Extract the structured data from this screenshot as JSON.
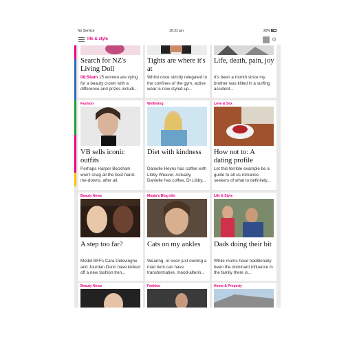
{
  "status_bar": {
    "carrier": "No Service",
    "time": "10:31 am",
    "battery": "20%"
  },
  "header": {
    "section_title": "life & style"
  },
  "cards": [
    {
      "title": "Search for NZ's Living Doll",
      "time": "08:54am",
      "desc": "15 women are vying for a beauty crown with a difference and prizes includi..."
    },
    {
      "title": "Tights are where it's at",
      "desc": "Whilst once strictly relegated to the confines of the gym, active wear is now styled-up..."
    },
    {
      "title": "Life, death, pain, joy",
      "desc": "It's been a month since my brother was killed in a surfing accident..."
    },
    {
      "category": "Fashion",
      "title": "VB sells iconic outfits",
      "desc": "Perhaps Harper Beckham won't snag all the best hand-me-downs, after all."
    },
    {
      "category": "Wellbeing",
      "title": "Diet with kindness",
      "desc": "Danielle Heyns has coffee with Libby Weaver. Actually, Danielle has coffee, Dr Libby..."
    },
    {
      "category": "Love & Sex",
      "title": "How not to: A dating profile",
      "desc": "Let this terrible example be a guide to all us romance seekers of what to definitely..."
    },
    {
      "category": "Beauty News",
      "title": "A step too far?",
      "desc": "Model BFFs Cara Delevingne and Jourdan Dunn have kicked off a new fashion tren..."
    },
    {
      "category": "Moata's Blog Idle",
      "title": "Cats on my ankles",
      "desc": "Wearing, or even just owning a mad item can have transformative, mood-alterin..."
    },
    {
      "category": "Life & Style",
      "title": "Dads doing their bit",
      "desc": "While mums have traditionally been the dominant influence in the family there is..."
    },
    {
      "category": "Beauty News"
    },
    {
      "category": "Fashion"
    },
    {
      "category": "Home & Property"
    }
  ],
  "colors": {
    "accent": "#e6007e",
    "sidebar": [
      "#e6007e",
      "#2c69b4",
      "#1aa037",
      "#f28c1e",
      "#f6c700"
    ]
  },
  "icons": [
    "menu-icon",
    "user-avatar-icon",
    "settings-icon",
    "battery-icon",
    "wifi-icon"
  ]
}
